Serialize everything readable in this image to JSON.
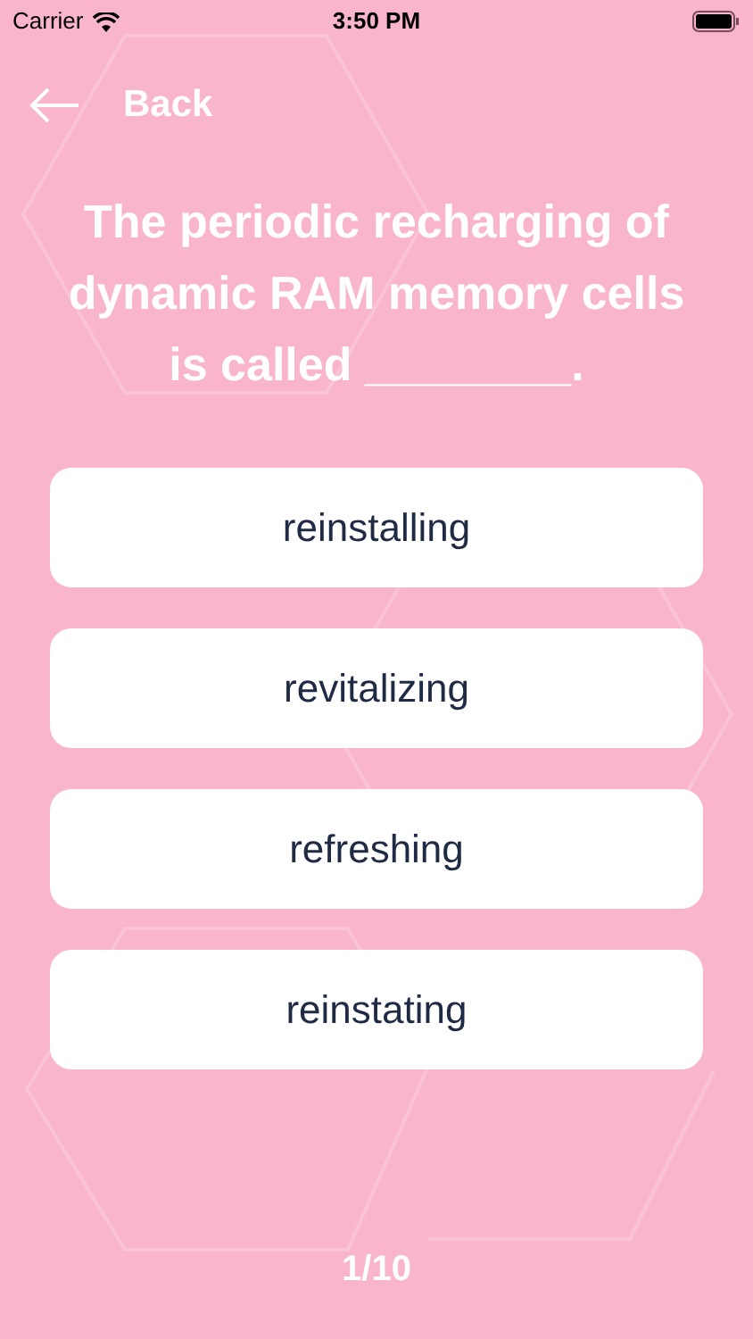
{
  "status_bar": {
    "carrier": "Carrier",
    "time": "3:50 PM"
  },
  "header": {
    "back_label": "Back"
  },
  "question": "The periodic recharging of dynamic RAM memory cells is called ________.",
  "answers": [
    {
      "label": "reinstalling"
    },
    {
      "label": "revitalizing"
    },
    {
      "label": "refreshing"
    },
    {
      "label": "reinstating"
    }
  ],
  "progress": "1/10"
}
